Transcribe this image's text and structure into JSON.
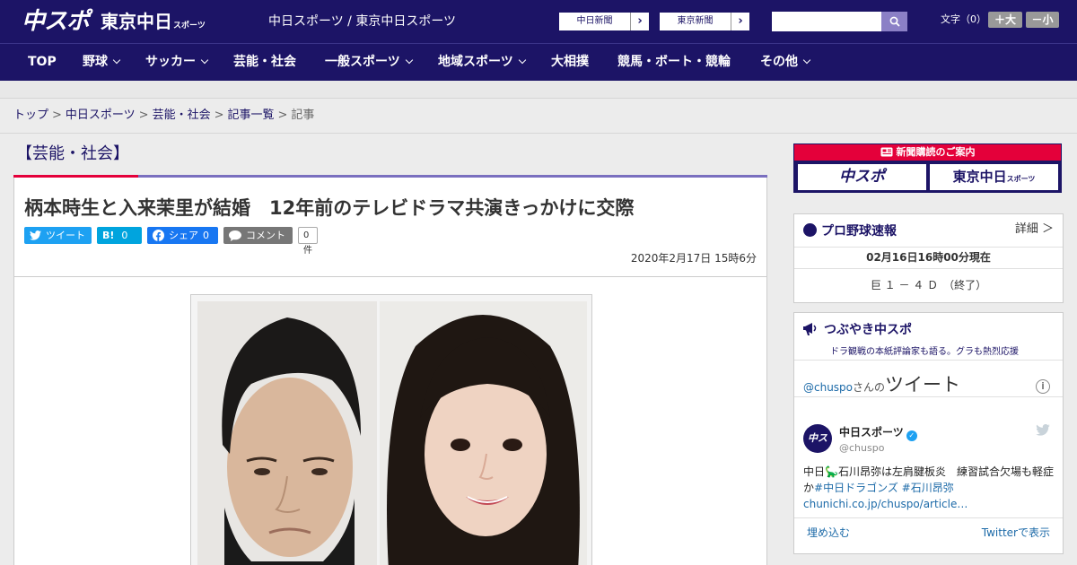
{
  "header": {
    "logo_chuspo": "中スポ",
    "logo_tokyo": "東京中日",
    "logo_tokyo_small": "スポーツ",
    "site_link": "中日スポーツ / 東京中日スポーツ",
    "sister_sites": [
      {
        "label": "中日新聞"
      },
      {
        "label": "東京新聞"
      }
    ],
    "search_placeholder": "",
    "font_size_label": "文字（0）",
    "font_larger": "＋大",
    "font_smaller": "－小"
  },
  "nav": [
    {
      "label": "TOP",
      "dropdown": false
    },
    {
      "label": "野球",
      "dropdown": true
    },
    {
      "label": "サッカー",
      "dropdown": true
    },
    {
      "label": "芸能・社会",
      "dropdown": false
    },
    {
      "label": "一般スポーツ",
      "dropdown": true
    },
    {
      "label": "地域スポーツ",
      "dropdown": true
    },
    {
      "label": "大相撲",
      "dropdown": false
    },
    {
      "label": "競馬・ボート・競輪",
      "dropdown": false
    },
    {
      "label": "その他",
      "dropdown": true
    }
  ],
  "breadcrumb": {
    "items": [
      "トップ",
      "中日スポーツ",
      "芸能・社会",
      "記事一覧"
    ],
    "current": "記事"
  },
  "article": {
    "category": "【芸能・社会】",
    "headline": "柄本時生と入来茉里が結婚　12年前のテレビドラマ共演きっかけに交際",
    "share": {
      "tweet": "ツイート",
      "hatena": "B!",
      "hatena_count": "0",
      "facebook": "シェア",
      "facebook_count": "0",
      "comment": "コメント",
      "comment_count": "0件"
    },
    "date": "2020年2月17日 15時6分"
  },
  "sidebar": {
    "subscribe": {
      "title": "新聞購読のご案内",
      "left": "中スポ",
      "right": "東京中日",
      "right_small": "スポーツ"
    },
    "baseball": {
      "title": "プロ野球速報",
      "more": "詳細 ＞",
      "timestamp": "02月16日16時00分現在",
      "score": "巨 １ － ４ Ｄ　（終了）"
    },
    "tweets": {
      "title": "つぶやき中スポ",
      "subtitle": "ドラ観戦の本紙評論家も語る。グラも熱烈応援",
      "handle_prefix": "@chuspo",
      "handle_suffix": "さんの",
      "header_big": "ツイート",
      "account_name": "中日スポーツ",
      "account_handle": "@chuspo",
      "avatar_text": "中スポ",
      "tweet_text_1": "中日🦕石川昂弥は左肩腱板炎　練習試合欠場も軽症か",
      "tweet_tag_1": "#中日ドラゴンズ",
      "tweet_tag_2": "#石川昂弥",
      "tweet_link": "chunichi.co.jp/chuspo/article…",
      "embed": "埋め込む",
      "view_on_twitter": "Twitterで表示"
    }
  },
  "colors": {
    "navy": "#1c1466",
    "red": "#e4003a",
    "purple_bar": "#7a6fbf",
    "twitter": "#1da1f2",
    "facebook": "#1877f2",
    "hatena": "#00a4de"
  }
}
